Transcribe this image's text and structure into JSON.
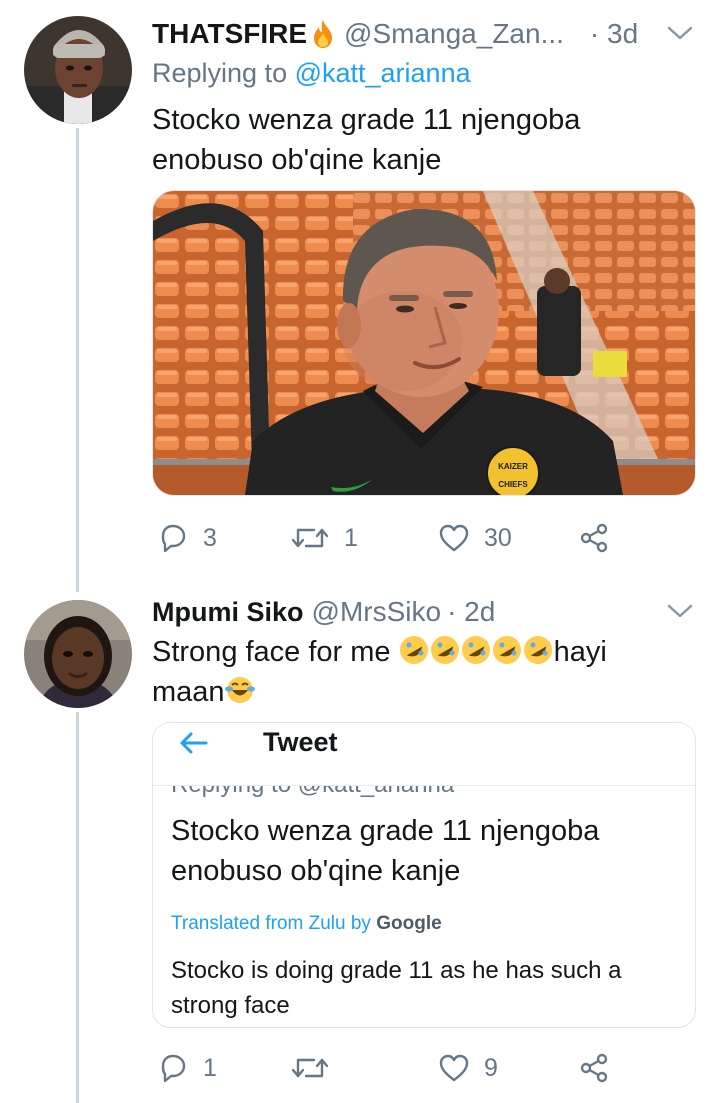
{
  "tweet1": {
    "display_name": "THATSFIRE",
    "handle": "@Smanga_Zan...",
    "time": "· 3d",
    "reply_prefix": "Replying to ",
    "reply_to": "@katt_arianna",
    "text_line1": "Stocko wenza grade 11 njengoba",
    "text_line2": "enobuso ob'qine kanje",
    "stats": {
      "replies": "3",
      "retweets": "1",
      "likes": "30"
    }
  },
  "tweet2": {
    "display_name": "Mpumi Siko",
    "handle": "@MrsSiko",
    "time": "· 2d",
    "text_line1_before": "Strong face for me ",
    "text_line1_after": "hayi",
    "text_line2": "maan",
    "stats": {
      "replies": "1",
      "retweets": "",
      "likes": "9"
    }
  },
  "quoted_card": {
    "header_title": "Tweet",
    "cut_reply_text": "Replying to @katt_arianna",
    "text_line1": "Stocko wenza grade 11 njengoba",
    "text_line2": "enobuso ob'qine kanje",
    "translated_prefix": "Translated from Zulu by ",
    "translated_brand": "Google",
    "translation_line1": "Stocko is doing grade 11 as he has such a",
    "translation_line2": "strong face"
  },
  "photo": {
    "badge_line1": "KAIZER",
    "badge_line2": "CHIEFS"
  },
  "colors": {
    "accent": "#1da1f2",
    "secondary_text": "#657786",
    "thread_line": "#ccd6dd",
    "stadium_orange": "#e8824a"
  }
}
